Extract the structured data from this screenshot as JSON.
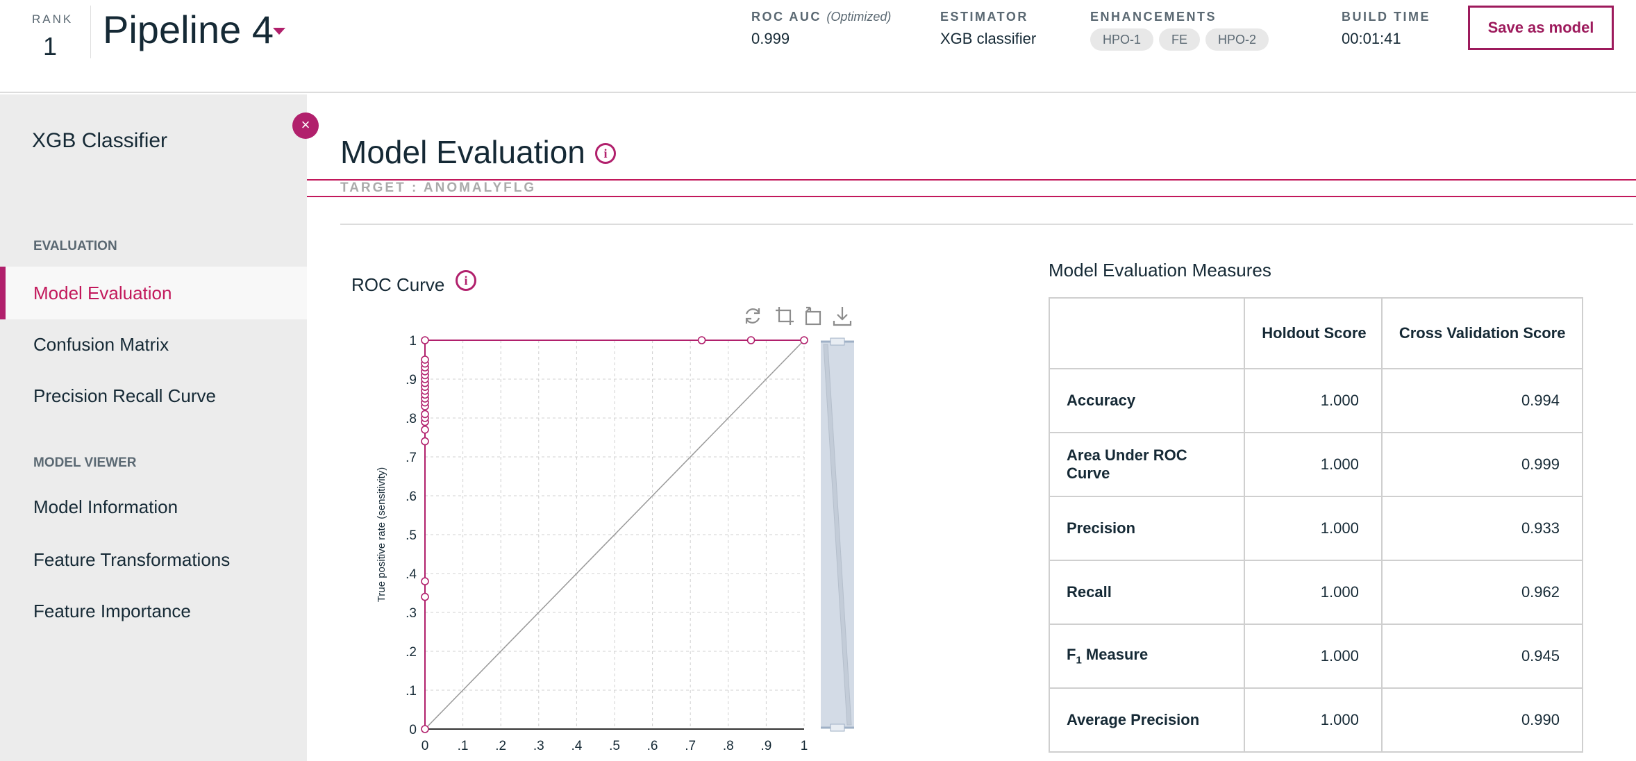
{
  "header": {
    "rank_label": "RANK",
    "rank_value": "1",
    "pipeline_title": "Pipeline 4",
    "roc_auc_label": "ROC AUC",
    "roc_auc_sub": "(Optimized)",
    "roc_auc_value": "0.999",
    "estimator_label": "ESTIMATOR",
    "estimator_value": "XGB classifier",
    "enhancements_label": "ENHANCEMENTS",
    "enhancements": [
      "HPO-1",
      "FE",
      "HPO-2"
    ],
    "build_time_label": "BUILD TIME",
    "build_time_value": "00:01:41",
    "save_label": "Save as model"
  },
  "sidebar": {
    "title": "XGB Classifier",
    "close_glyph": "×",
    "sections": [
      {
        "label": "EVALUATION",
        "items": [
          "Model Evaluation",
          "Confusion Matrix",
          "Precision Recall Curve"
        ]
      },
      {
        "label": "MODEL VIEWER",
        "items": [
          "Model Information",
          "Feature Transformations",
          "Feature Importance"
        ]
      }
    ],
    "active_item": "Model Evaluation"
  },
  "main": {
    "title": "Model Evaluation",
    "info_glyph": "i",
    "target": "TARGET : ANOMALYFLG",
    "roc_title": "ROC Curve",
    "toolbar_icons": [
      "refresh-icon",
      "zoom-select-icon",
      "zoom-reset-icon",
      "download-icon"
    ]
  },
  "chart_data": {
    "type": "line",
    "title": "ROC Curve",
    "xlabel": "",
    "ylabel": "True positive rate (sensitivity)",
    "xlim": [
      0,
      1
    ],
    "ylim": [
      0,
      1
    ],
    "x_ticks": [
      "0",
      ".1",
      ".2",
      ".3",
      ".4",
      ".5",
      ".6",
      ".7",
      ".8",
      ".9",
      "1"
    ],
    "y_ticks": [
      "0",
      ".1",
      ".2",
      ".3",
      ".4",
      ".5",
      ".6",
      ".7",
      ".8",
      ".9",
      "1"
    ],
    "grid": true,
    "series": [
      {
        "x": [
          0,
          0,
          0,
          0,
          0,
          0,
          0,
          0,
          0,
          0,
          0,
          0,
          0,
          0,
          0,
          0,
          0,
          0,
          0,
          0,
          0,
          0,
          0.73,
          0.86,
          1
        ],
        "y": [
          0,
          0.34,
          0.38,
          0.74,
          0.77,
          0.79,
          0.8,
          0.81,
          0.83,
          0.84,
          0.85,
          0.86,
          0.87,
          0.88,
          0.89,
          0.9,
          0.91,
          0.92,
          0.93,
          0.94,
          0.95,
          1,
          1,
          1,
          1
        ]
      },
      {
        "x": [
          0,
          1
        ],
        "y": [
          0,
          1
        ]
      }
    ],
    "colors": {
      "roc": "#b1206c",
      "diagonal": "#9a9a9a",
      "grid": "#d0d0d0",
      "scroll": "#d3dbe6"
    }
  },
  "measures": {
    "title": "Model Evaluation Measures",
    "columns": [
      "",
      "Holdout Score",
      "Cross Validation Score"
    ],
    "rows": [
      {
        "name": "Accuracy",
        "holdout": "1.000",
        "cv": "0.994"
      },
      {
        "name": "Area Under ROC Curve",
        "holdout": "1.000",
        "cv": "0.999"
      },
      {
        "name": "Precision",
        "holdout": "1.000",
        "cv": "0.933"
      },
      {
        "name": "Recall",
        "holdout": "1.000",
        "cv": "0.962"
      },
      {
        "name": "F",
        "sub": "1",
        "suffix": " Measure",
        "holdout": "1.000",
        "cv": "0.945"
      },
      {
        "name": "Average Precision",
        "holdout": "1.000",
        "cv": "0.990"
      }
    ]
  }
}
